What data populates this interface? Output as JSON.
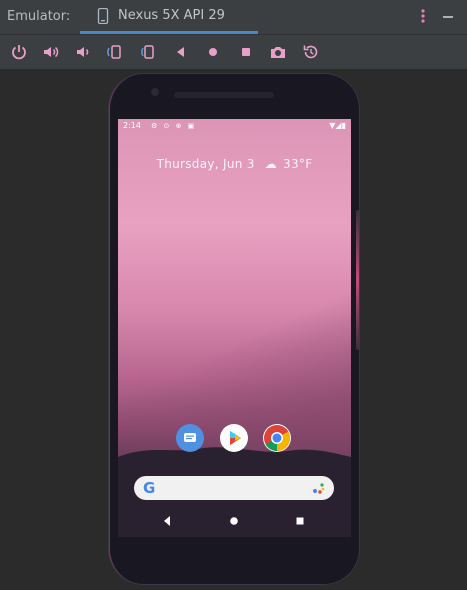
{
  "titlebar": {
    "label": "Emulator:",
    "tab_label": "Nexus 5X API 29",
    "tab_icon": "device-icon",
    "menu_icon": "more-vert-icon",
    "minimize_icon": "minimize-icon"
  },
  "toolbar": {
    "buttons": [
      {
        "name": "power-icon",
        "tooltip": "Power"
      },
      {
        "name": "volume-up-icon",
        "tooltip": "Volume up"
      },
      {
        "name": "volume-down-icon",
        "tooltip": "Volume down"
      },
      {
        "name": "rotate-left-icon",
        "tooltip": "Rotate left"
      },
      {
        "name": "rotate-right-icon",
        "tooltip": "Rotate right"
      },
      {
        "name": "back-icon",
        "tooltip": "Back"
      },
      {
        "name": "home-icon",
        "tooltip": "Home"
      },
      {
        "name": "overview-icon",
        "tooltip": "Overview"
      },
      {
        "name": "camera-icon",
        "tooltip": "Take screenshot"
      },
      {
        "name": "snapshot-icon",
        "tooltip": "Snapshot"
      }
    ],
    "icon_color": "#e8a0c8"
  },
  "device": {
    "status_time": "2:14",
    "status_icons_left": "⚙ ⊙ ⊕ ▣",
    "status_icons_right": "▼◢▮",
    "glance_date": "Thursday, Jun 3",
    "glance_weather_icon": "cloud-icon",
    "glance_temp": "33°F",
    "dock_apps": [
      "messages-icon",
      "play-store-icon",
      "chrome-icon"
    ],
    "search_logo": "G",
    "nav": [
      "nav-back-icon",
      "nav-home-icon",
      "nav-recents-icon"
    ]
  },
  "colors": {
    "accent": "#4a88c7",
    "toolbar_icon": "#e8a0c8",
    "wallpaper_top": "#dc95b6",
    "wallpaper_bottom": "#5a3751"
  }
}
